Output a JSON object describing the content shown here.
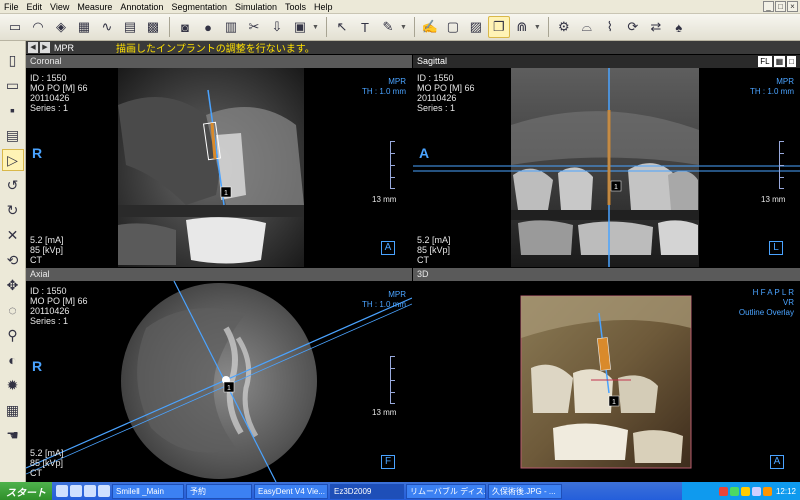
{
  "menu": [
    "File",
    "Edit",
    "View",
    "Measure",
    "Annotation",
    "Segmentation",
    "Simulation",
    "Tools",
    "Help"
  ],
  "window_controls": [
    "_",
    "□",
    "×"
  ],
  "toolbar": {
    "icons": [
      "layout-icon",
      "panorama-icon",
      "3d-icon",
      "volume-icon",
      "waveform-icon",
      "sharpen-icon",
      "grid-icon",
      "camera-icon",
      "patient-icon",
      "report-icon",
      "tools-icon",
      "export-icon",
      "book-icon",
      "pointer-icon",
      "text-icon",
      "pencil-icon",
      "edit-icon",
      "screenshot-icon",
      "image-icon",
      "overlay-icon",
      "teeth-icon",
      "implant-icon",
      "tooth-icon",
      "nerve-icon",
      "sync-icon",
      "mirror-icon"
    ],
    "selected": "overlay-icon"
  },
  "sidebar": {
    "icons": [
      "document-icon",
      "open-folder-icon",
      "save-icon",
      "print-icon",
      "pointer-icon",
      "rotate-left-icon",
      "rotate-right-icon",
      "close-icon",
      "reset-icon",
      "move-icon",
      "rotate-icon",
      "zoom-icon",
      "contrast-icon",
      "brightness-icon",
      "filter-icon",
      "hand-icon"
    ],
    "selected": "pointer-icon"
  },
  "hint": {
    "mode": "MPR",
    "message": "描画したインプラントの調整を行ないます。"
  },
  "panes": {
    "coronal": {
      "title": "Coronal",
      "id": "ID : 1550",
      "name": "MO PO  [M] 66",
      "date": "20110426",
      "series": "Series : 1",
      "mpr": "MPR",
      "th": "TH : 1.0 mm",
      "orient_left": "R",
      "orient_box": "A",
      "scale": "13 mm",
      "ma": "5.2 [mA]",
      "kvp": "85 [kVp]",
      "modality": "CT",
      "implant_num": "1"
    },
    "sagittal": {
      "title": "Sagittal",
      "fl": "FL",
      "id": "ID : 1550",
      "name": "MO PO  [M] 66",
      "date": "20110426",
      "series": "Series : 1",
      "mpr": "MPR",
      "th": "TH : 1.0 mm",
      "orient_left": "A",
      "orient_box": "L",
      "scale": "13 mm",
      "ma": "5.2 [mA]",
      "kvp": "85 [kVp]",
      "modality": "CT",
      "implant_num": "1"
    },
    "axial": {
      "title": "Axial",
      "id": "ID : 1550",
      "name": "MO PO  [M] 66",
      "date": "20110426",
      "series": "Series : 1",
      "mpr": "MPR",
      "th": "TH : 1.0 mm",
      "orient_left": "R",
      "orient_box": "F",
      "scale": "13 mm",
      "ma": "5.2 [mA]",
      "kvp": "85 [kVp]",
      "modality": "CT",
      "implant_num": "1"
    },
    "threed": {
      "title": "3D",
      "orient_code": "H F A P L R",
      "vr": "VR",
      "outline": "Outline Overlay",
      "orient_box": "A",
      "implant_num": "1"
    }
  },
  "taskbar": {
    "start": "スタート",
    "tasks": [
      "SmileⅡ _Main",
      "予約",
      "EasyDent V4 Vie...",
      "Ez3D2009",
      "リムーバブル ディス...",
      "久保術後.JPG - ..."
    ],
    "active_task": "Ez3D2009",
    "clock": "12:12"
  },
  "colors": {
    "accent_blue": "#4aa3ff",
    "hint_yellow": "#ffe100",
    "implant_orange": "#d98a2b",
    "taskbar_blue": "#245edb"
  }
}
